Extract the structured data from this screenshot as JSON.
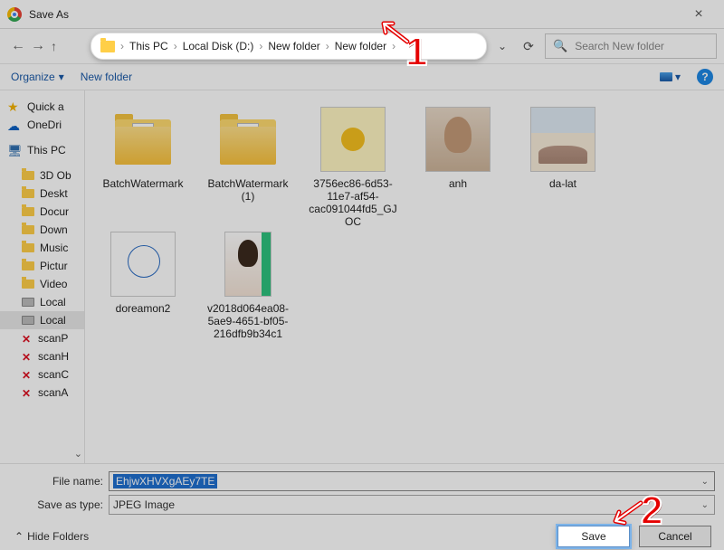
{
  "window": {
    "title": "Save As",
    "close": "×"
  },
  "breadcrumb": {
    "segments": [
      "This PC",
      "Local Disk (D:)",
      "New folder",
      "New folder"
    ],
    "sep": "›"
  },
  "search": {
    "placeholder": "Search New folder",
    "icon": "🔍"
  },
  "toolbar": {
    "organize": "Organize",
    "organize_caret": "▾",
    "new_folder": "New folder",
    "view_caret": "▾",
    "help": "?"
  },
  "nav": {
    "back": "←",
    "fwd": "→",
    "up": "↑",
    "refresh": "⟳",
    "addr_drop": "⌄"
  },
  "sidebar": {
    "items": [
      {
        "label": "Quick a",
        "icon": "star",
        "kind": "top"
      },
      {
        "label": "OneDri",
        "icon": "cloud",
        "kind": "top"
      },
      {
        "label": "This PC",
        "icon": "pc",
        "kind": "top"
      },
      {
        "label": "3D Ob",
        "icon": "folder",
        "kind": "indent"
      },
      {
        "label": "Deskt",
        "icon": "folder",
        "kind": "indent"
      },
      {
        "label": "Docur",
        "icon": "folder",
        "kind": "indent"
      },
      {
        "label": "Down",
        "icon": "folder",
        "kind": "indent"
      },
      {
        "label": "Music",
        "icon": "folder",
        "kind": "indent"
      },
      {
        "label": "Pictur",
        "icon": "folder",
        "kind": "indent"
      },
      {
        "label": "Video",
        "icon": "folder",
        "kind": "indent"
      },
      {
        "label": "Local",
        "icon": "drive",
        "kind": "indent"
      },
      {
        "label": "Local",
        "icon": "drive",
        "kind": "indent",
        "sel": true
      },
      {
        "label": "scanP",
        "icon": "red",
        "kind": "indent"
      },
      {
        "label": "scanH",
        "icon": "red",
        "kind": "indent"
      },
      {
        "label": "scanC",
        "icon": "red",
        "kind": "indent"
      },
      {
        "label": "scanA",
        "icon": "red",
        "kind": "indent"
      }
    ],
    "expand": "⌄"
  },
  "files": [
    {
      "name": "BatchWatermark",
      "thumb": "folder"
    },
    {
      "name": "BatchWatermark (1)",
      "thumb": "folder"
    },
    {
      "name": "3756ec86-6d53-11e7-af54-cac091044fd5_GJOC",
      "thumb": "yellow"
    },
    {
      "name": "anh",
      "thumb": "anh"
    },
    {
      "name": "da-lat",
      "thumb": "dalat"
    },
    {
      "name": "doreamon2",
      "thumb": "dora"
    },
    {
      "name": "v2018d064ea08-5ae9-4651-bf05-216dfb9b34c1",
      "thumb": "girl"
    }
  ],
  "form": {
    "file_name_label": "File name:",
    "file_name_value": "EhjwXHVXgAEy7TE",
    "save_type_label": "Save as type:",
    "save_type_value": "JPEG Image",
    "hide_folders": "Hide Folders",
    "hide_caret": "⌃",
    "save": "Save",
    "cancel": "Cancel",
    "dropdown_caret": "⌄"
  },
  "callouts": {
    "one": "1",
    "two": "2"
  }
}
